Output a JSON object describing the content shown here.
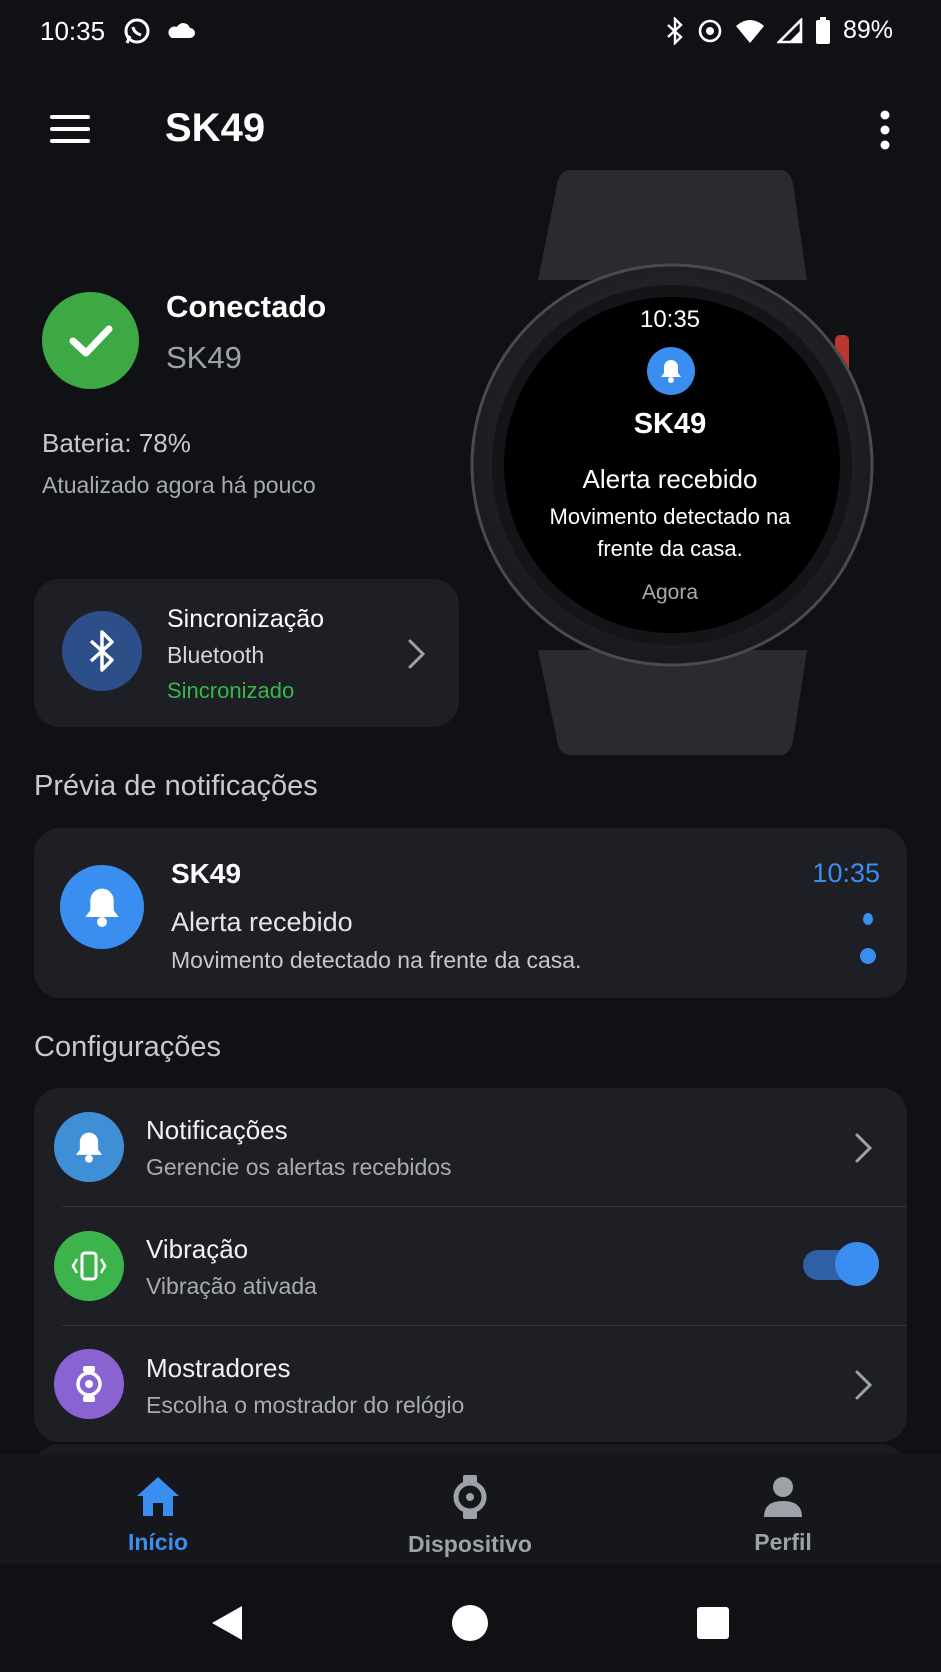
{
  "status_bar": {
    "time": "10:35",
    "left_icons": [
      "whatsapp-icon",
      "cloud-icon"
    ],
    "right_icons": [
      "bluetooth-icon",
      "location-icon",
      "wifi-icon",
      "signal-icon",
      "battery-icon"
    ],
    "battery": "89%"
  },
  "app_bar": {
    "title": "SK49"
  },
  "connection": {
    "status": "Conectado",
    "device": "SK49",
    "battery": "Bateria: 78%",
    "updated": "Atualizado agora há pouco",
    "status_color": "#3da944"
  },
  "sync": {
    "title": "Sincronização",
    "method": "Bluetooth",
    "state": "Sincronizado",
    "state_color": "#35b84a"
  },
  "watch_face": {
    "time": "10:35",
    "device": "SK49",
    "alert_title": "Alerta recebido",
    "alert_message": "Movimento detectado na frente da casa.",
    "when": "Agora"
  },
  "notifications_preview": {
    "section_title": "Prévia de notificações",
    "app": "SK49",
    "time": "10:35",
    "title": "Alerta recebido",
    "body": "Movimento detectado na frente da casa.",
    "accent": "#3a8ef0"
  },
  "settings": {
    "section_title": "Configurações",
    "items": [
      {
        "title": "Notificações",
        "subtitle": "Gerencie os alertas recebidos",
        "icon": "bell-icon",
        "color": "#3f8fd6"
      },
      {
        "title": "Vibração",
        "subtitle": "Vibração ativada",
        "icon": "vibration-icon",
        "color": "#3db34c",
        "toggle_on": true
      },
      {
        "title": "Mostradores",
        "subtitle": "Escolha o mostrador do relógio",
        "icon": "watch-face-icon",
        "color": "#8a63d2"
      }
    ]
  },
  "bottom_nav": {
    "items": [
      {
        "label": "Início",
        "icon": "home-icon",
        "active": true
      },
      {
        "label": "Dispositivo",
        "icon": "watch-icon",
        "active": false
      },
      {
        "label": "Perfil",
        "icon": "person-icon",
        "active": false
      }
    ]
  }
}
